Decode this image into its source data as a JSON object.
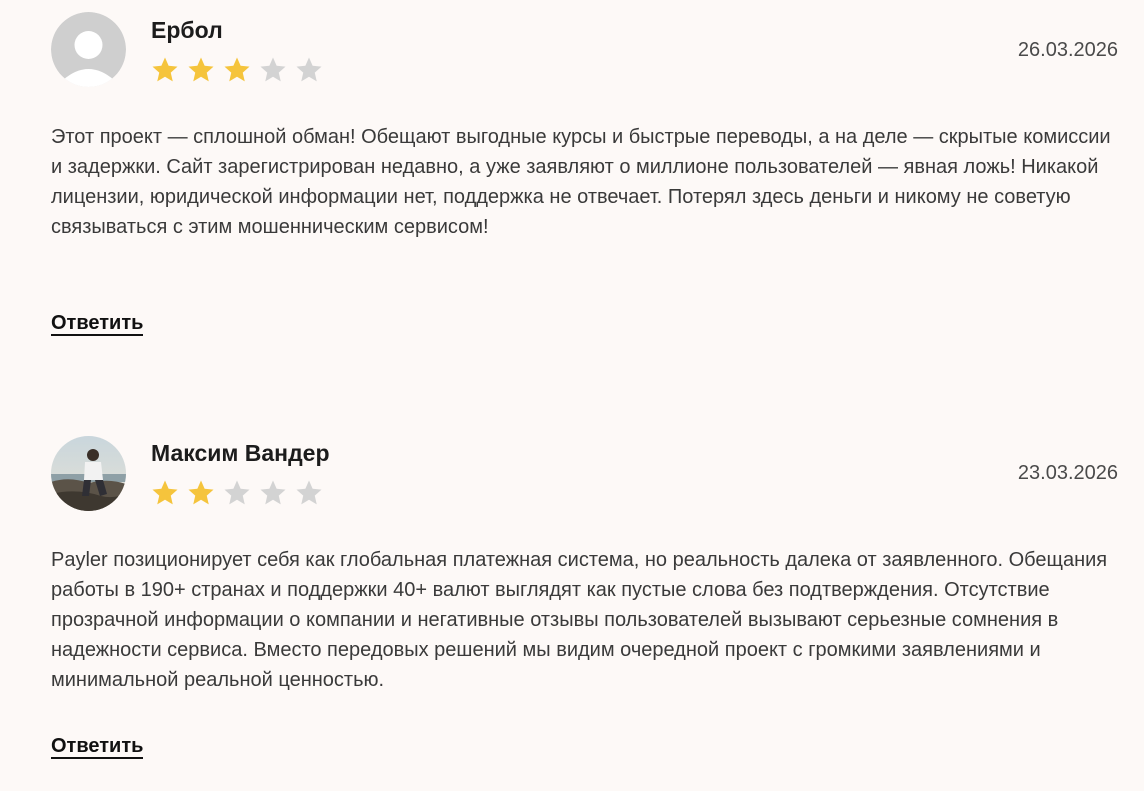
{
  "colors": {
    "background": "#fdf9f7",
    "star_filled": "#f5c43c",
    "star_empty": "#d3d3d3",
    "text": "#3a3a3a",
    "author": "#1c1c1c"
  },
  "reviews": [
    {
      "author": "Ербол",
      "date": "26.03.2026",
      "rating": 3,
      "rating_max": 5,
      "avatar": "default-user-avatar-icon",
      "text": "Этот проект — сплошной обман! Обещают выгодные курсы и быстрые переводы, а на деле — скрытые комиссии и задержки. Сайт зарегистрирован недавно, а уже заявляют о миллионе пользователей — явная ложь! Никакой лицензии, юридической информации нет, поддержка не отвечает. Потерял здесь деньги и никому не советую связываться с этим мошенническим сервисом!",
      "reply_label": "Ответить"
    },
    {
      "author": "Максим Вандер",
      "date": "23.03.2026",
      "rating": 2,
      "rating_max": 5,
      "avatar": "user-photo-avatar",
      "text": "Payler позиционирует себя как глобальная платежная система, но реальность далека от заявленного. Обещания работы в 190+ странах и поддержки 40+ валют выглядят как пустые слова без подтверждения. Отсутствие прозрачной информации о компании и негативные отзывы пользователей вызывают серьезные сомнения в надежности сервиса. Вместо передовых решений мы видим очередной проект с громкими заявлениями и минимальной реальной ценностью.",
      "reply_label": "Ответить"
    }
  ]
}
